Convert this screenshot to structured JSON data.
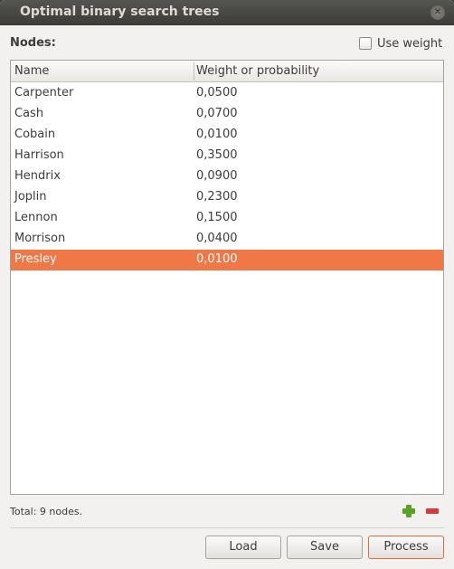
{
  "window": {
    "title": "Optimal binary search trees"
  },
  "nodes_label": "Nodes:",
  "use_weight": {
    "label": "Use weight",
    "checked": false
  },
  "table": {
    "columns": [
      "Name",
      "Weight or probability"
    ],
    "rows": [
      {
        "name": "Carpenter",
        "weight": "0,0500"
      },
      {
        "name": "Cash",
        "weight": "0,0700"
      },
      {
        "name": "Cobain",
        "weight": "0,0100"
      },
      {
        "name": "Harrison",
        "weight": "0,3500"
      },
      {
        "name": "Hendrix",
        "weight": "0,0900"
      },
      {
        "name": "Joplin",
        "weight": "0,2300"
      },
      {
        "name": "Lennon",
        "weight": "0,1500"
      },
      {
        "name": "Morrison",
        "weight": "0,0400"
      },
      {
        "name": "Presley",
        "weight": "0,0100"
      }
    ],
    "selected_row": 8
  },
  "total": "Total: 9 nodes.",
  "buttons": {
    "load": "Load",
    "save": "Save",
    "process": "Process"
  },
  "icons": {
    "add": "plus-icon",
    "remove": "minus-icon",
    "close": "close-icon"
  },
  "colors": {
    "selection": "#f07746",
    "add": "#5aa223",
    "remove": "#d53b3b"
  }
}
